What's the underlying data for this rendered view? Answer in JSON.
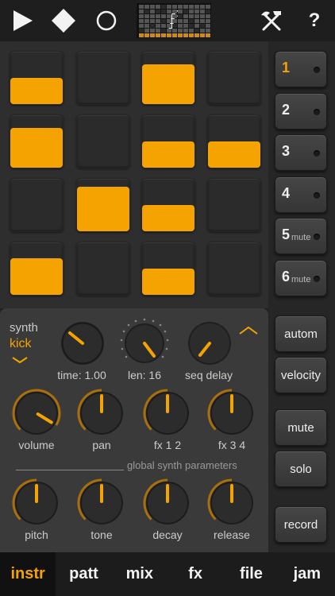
{
  "toolbar": {
    "play_icon": "play-icon",
    "stop_icon": "stop-icon",
    "record_icon": "circle-icon",
    "tools_icon": "hammer-pick-icon",
    "help_label": "?",
    "logo_text": "f"
  },
  "pads": [
    {
      "level": 0.5
    },
    {
      "level": 0
    },
    {
      "level": 0.75
    },
    {
      "level": 0
    },
    {
      "level": 0.75
    },
    {
      "level": 0
    },
    {
      "level": 0.5
    },
    {
      "level": 0.5
    },
    {
      "level": 0
    },
    {
      "level": 0.85
    },
    {
      "level": 0.5
    },
    {
      "level": 0
    },
    {
      "level": 0.7
    },
    {
      "level": 0
    },
    {
      "level": 0.5
    },
    {
      "level": 0
    }
  ],
  "instruments": [
    {
      "label": "1",
      "mute": "",
      "selected": true
    },
    {
      "label": "2",
      "mute": "",
      "selected": false
    },
    {
      "label": "3",
      "mute": "",
      "selected": false
    },
    {
      "label": "4",
      "mute": "",
      "selected": false
    },
    {
      "label": "5",
      "mute": "mute",
      "selected": false
    },
    {
      "label": "6",
      "mute": "mute",
      "selected": false
    }
  ],
  "side_buttons": {
    "autom": "autom",
    "velocity": "velocity",
    "mute": "mute",
    "solo": "solo",
    "record": "record"
  },
  "synth": {
    "label": "synth",
    "kind": "kick",
    "time": "time: 1.00",
    "len": "len: 16",
    "seq_delay": "seq delay",
    "global_label": "global synth parameters",
    "knobs_row1": [
      {
        "label": "volume",
        "value": 0.95
      },
      {
        "label": "pan",
        "value": 0.5
      },
      {
        "label": "fx 1 2",
        "value": 0.5
      },
      {
        "label": "fx 3 4",
        "value": 0.5
      }
    ],
    "knobs_row2": [
      {
        "label": "pitch",
        "value": 0.5
      },
      {
        "label": "tone",
        "value": 0.5
      },
      {
        "label": "decay",
        "value": 0.5
      },
      {
        "label": "release",
        "value": 0.5
      }
    ]
  },
  "tabs": [
    {
      "label": "instr",
      "active": true
    },
    {
      "label": "patt",
      "active": false
    },
    {
      "label": "mix",
      "active": false
    },
    {
      "label": "fx",
      "active": false
    },
    {
      "label": "file",
      "active": false
    },
    {
      "label": "jam",
      "active": false
    }
  ],
  "colors": {
    "accent": "#f5a300",
    "background": "#222222",
    "panel": "#3a3a3a"
  }
}
